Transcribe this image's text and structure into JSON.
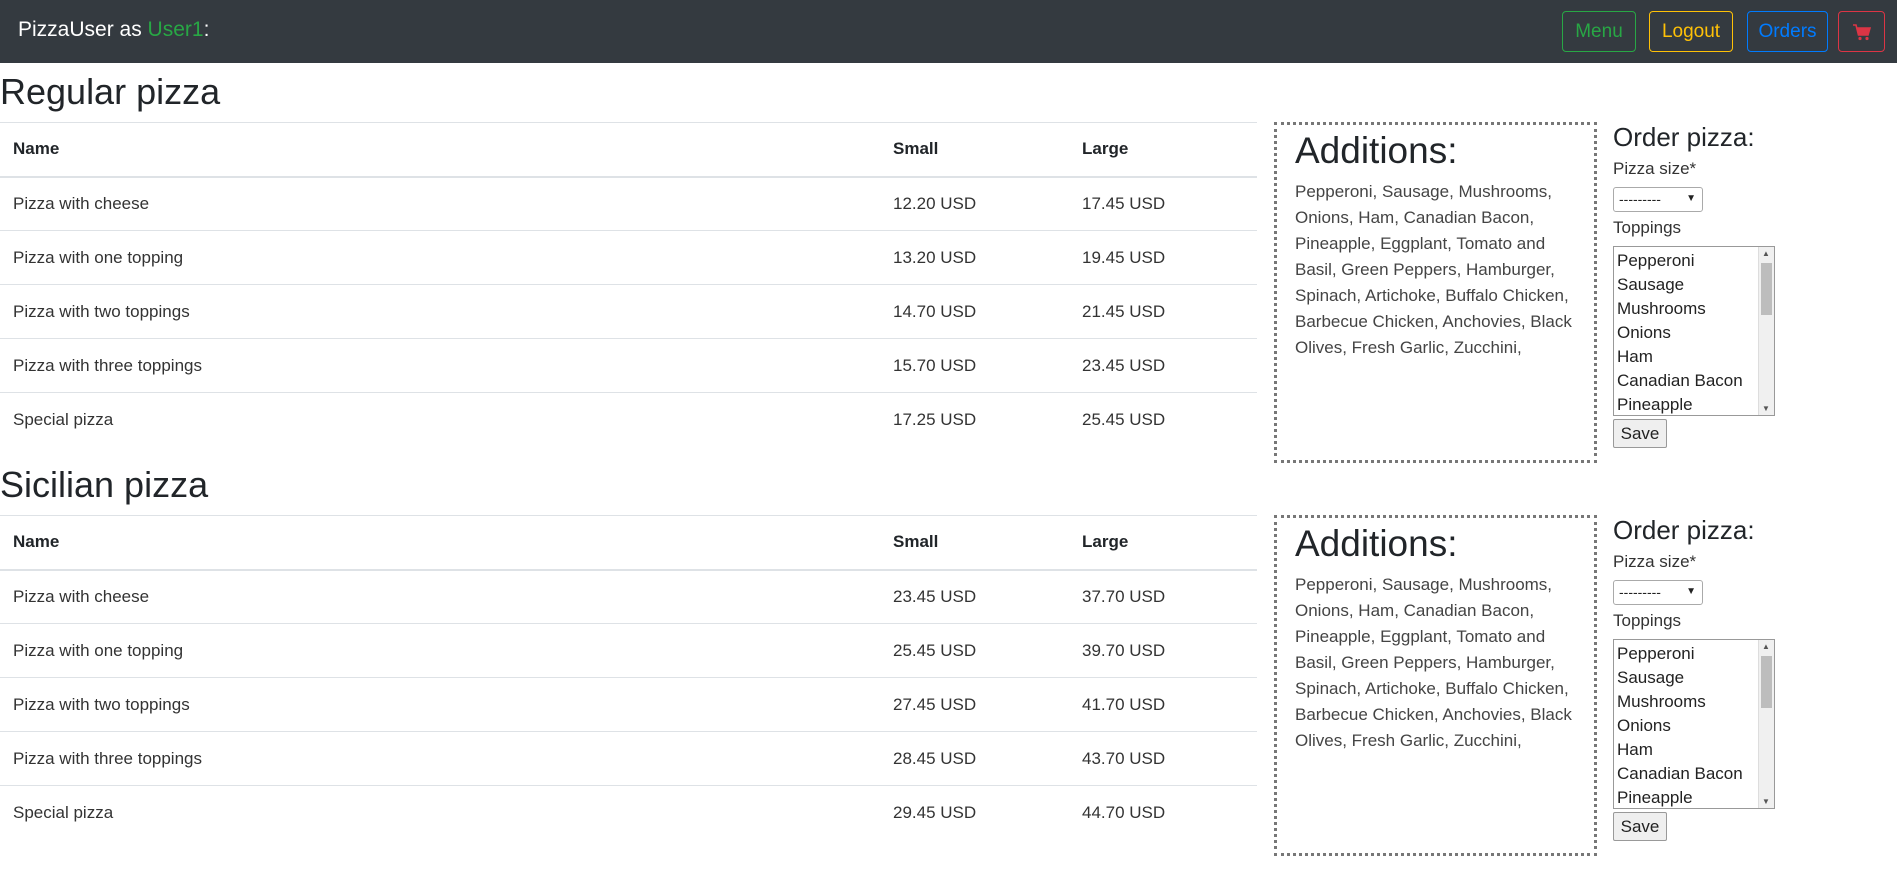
{
  "navbar": {
    "brand_prefix": "PizzaUser as ",
    "user": "User1",
    "brand_suffix": ":",
    "menu_label": "Menu",
    "logout_label": "Logout",
    "orders_label": "Orders",
    "cart_icon": "shopping-cart-icon"
  },
  "table_headers": {
    "name": "Name",
    "small": "Small",
    "large": "Large"
  },
  "sections": [
    {
      "title": "Regular pizza",
      "rows": [
        {
          "name": "Pizza with cheese",
          "small": "12.20 USD",
          "large": "17.45 USD"
        },
        {
          "name": "Pizza with one topping",
          "small": "13.20 USD",
          "large": "19.45 USD"
        },
        {
          "name": "Pizza with two toppings",
          "small": "14.70 USD",
          "large": "21.45 USD"
        },
        {
          "name": "Pizza with three toppings",
          "small": "15.70 USD",
          "large": "23.45 USD"
        },
        {
          "name": "Special pizza",
          "small": "17.25 USD",
          "large": "25.45 USD"
        }
      ]
    },
    {
      "title": "Sicilian pizza",
      "rows": [
        {
          "name": "Pizza with cheese",
          "small": "23.45 USD",
          "large": "37.70 USD"
        },
        {
          "name": "Pizza with one topping",
          "small": "25.45 USD",
          "large": "39.70 USD"
        },
        {
          "name": "Pizza with two toppings",
          "small": "27.45 USD",
          "large": "41.70 USD"
        },
        {
          "name": "Pizza with three toppings",
          "small": "28.45 USD",
          "large": "43.70 USD"
        },
        {
          "name": "Special pizza",
          "small": "29.45 USD",
          "large": "44.70 USD"
        }
      ]
    }
  ],
  "additions": {
    "title": "Additions:",
    "text": "Pepperoni, Sausage, Mushrooms, Onions, Ham, Canadian Bacon, Pineapple, Eggplant, Tomato and Basil, Green Peppers, Hamburger, Spinach, Artichoke, Buffalo Chicken, Barbecue Chicken, Anchovies, Black Olives, Fresh Garlic, Zucchini,"
  },
  "order": {
    "title": "Order pizza:",
    "size_label": "Pizza size*",
    "size_value": "---------",
    "toppings_label": "Toppings",
    "toppings": [
      "Pepperoni",
      "Sausage",
      "Mushrooms",
      "Onions",
      "Ham",
      "Canadian Bacon",
      "Pineapple"
    ],
    "save_label": "Save"
  },
  "colors": {
    "navbar_bg": "#343a40",
    "success": "#28a745",
    "warning": "#ffc107",
    "primary": "#007bff",
    "danger": "#dc3545"
  }
}
